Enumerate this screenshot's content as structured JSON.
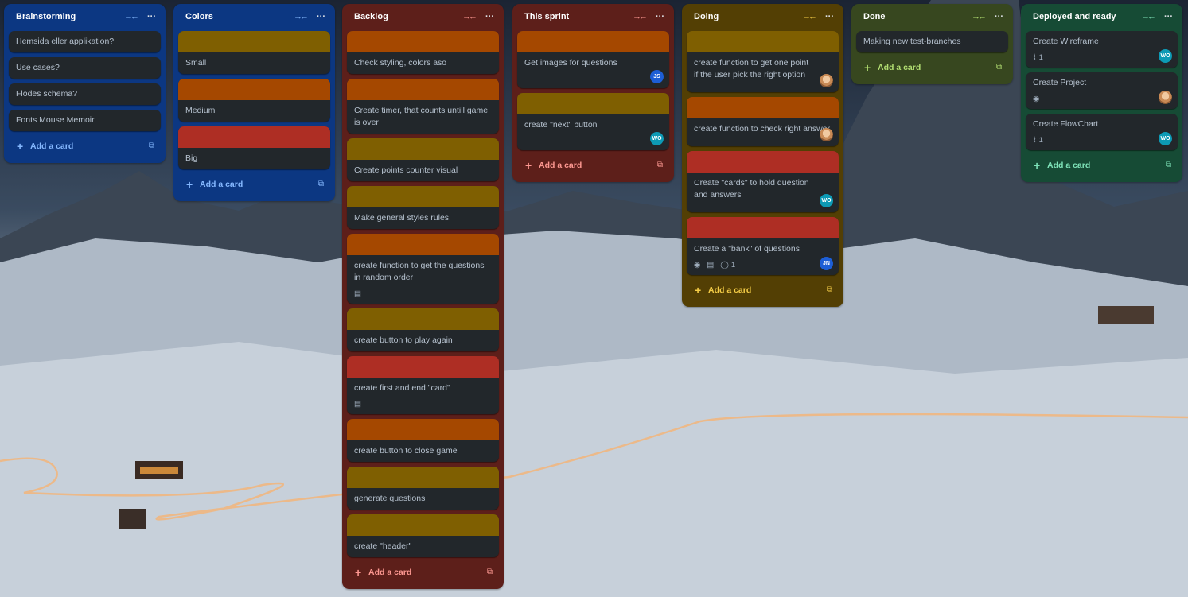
{
  "board": {
    "add_card_label": "Add a card"
  },
  "lists": [
    {
      "title": "Brainstorming",
      "cards": [
        "Hemsida eller applikation?",
        "Use cases?",
        "Flödes schema?",
        "Fonts Mouse Memoir"
      ]
    },
    {
      "title": "Colors",
      "cards": [
        "Small",
        "Medium",
        "Big"
      ]
    },
    {
      "title": "Backlog",
      "cards": [
        "Check styling, colors aso",
        "Create timer, that counts untill game is over",
        "Create points counter visual",
        "Make general styles rules.",
        "create function to get the questions in random order",
        "create button to play again",
        "create first and end \"card\"",
        "create button to close game",
        "generate questions",
        "create \"header\""
      ]
    },
    {
      "title": "This sprint",
      "cards": [
        {
          "text": "Get images for questions",
          "member": "JS"
        },
        {
          "text": "create \"next\" button",
          "member": "WO"
        }
      ]
    },
    {
      "title": "Doing",
      "cards": [
        {
          "text": "create function to get one point if the user pick the right option"
        },
        {
          "text": "create function to check right answer"
        },
        {
          "text": "Create \"cards\" to hold question and answers",
          "member": "WO"
        },
        {
          "text": "Create a \"bank\" of questions",
          "comments": "1",
          "member": "JN"
        }
      ]
    },
    {
      "title": "Done",
      "cards": [
        "Making new test-branches"
      ]
    },
    {
      "title": "Deployed and ready",
      "cards": [
        {
          "text": "Create Wireframe",
          "attachments": "1",
          "member": "WO"
        },
        {
          "text": "Create Project"
        },
        {
          "text": "Create FlowChart",
          "attachments": "1",
          "member": "WO"
        }
      ]
    }
  ],
  "colors": {
    "cover_olive": "#7f5f01",
    "cover_orange": "#a54800",
    "cover_red": "#ae2e24"
  },
  "icons": [
    "collapse-icon",
    "more-icon",
    "plus-icon",
    "template-icon",
    "description-icon",
    "watch-icon",
    "comment-icon",
    "attachment-icon"
  ]
}
